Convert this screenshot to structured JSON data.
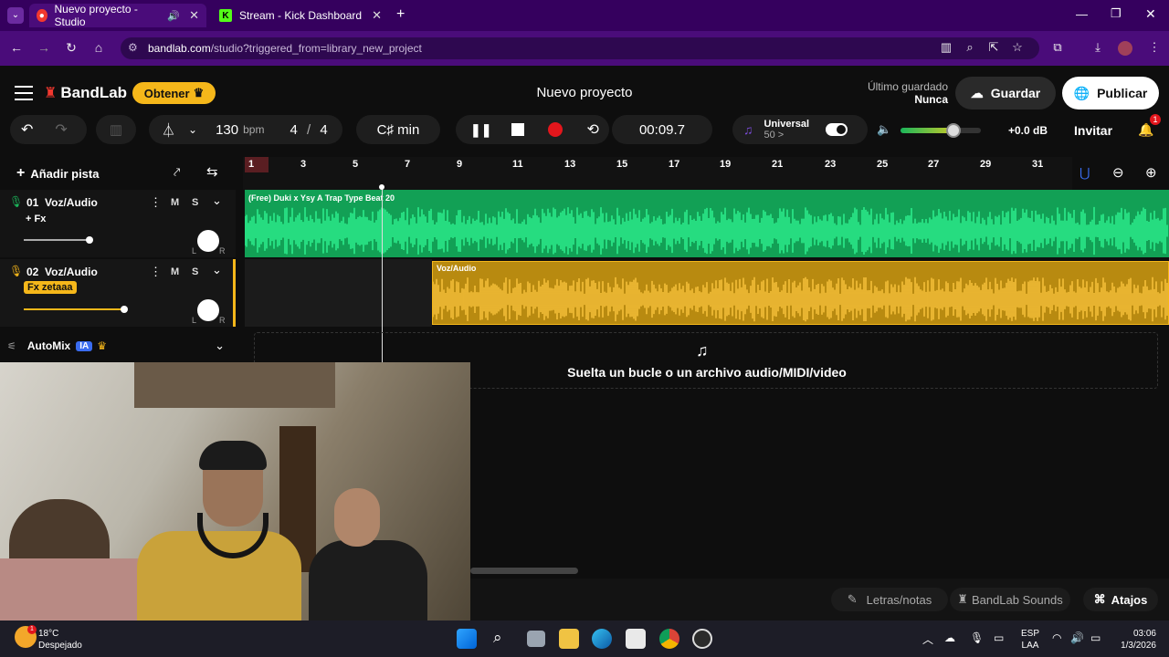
{
  "browser": {
    "tabs": [
      {
        "title": "Nuevo proyecto - Studio",
        "active": true
      },
      {
        "title": "Stream - Kick Dashboard",
        "active": false
      }
    ],
    "url_domain": "bandlab.com",
    "url_path": "/studio?triggered_from=library_new_project"
  },
  "header": {
    "logo": "BandLab",
    "obtener": "Obtener",
    "project_title": "Nuevo proyecto",
    "last_saved_label": "Último guardado",
    "last_saved_value": "Nunca",
    "guardar": "Guardar",
    "publicar": "Publicar"
  },
  "transport": {
    "bpm_value": "130",
    "bpm_unit": "bpm",
    "time_sig_num": "4",
    "time_sig_sep": "/",
    "time_sig_den": "4",
    "key": "C♯ min",
    "time": "00:09.7",
    "preset_name": "Universal",
    "preset_value": "50 >",
    "volume_db": "+0.0 dB",
    "invitar": "Invitar",
    "notifications": "1"
  },
  "timeline": {
    "add_track": "Añadir pista",
    "ruler": [
      "1",
      "3",
      "5",
      "7",
      "9",
      "11",
      "13",
      "15",
      "17",
      "19",
      "21",
      "23",
      "25",
      "27",
      "29",
      "31"
    ]
  },
  "tracks": [
    {
      "number": "01",
      "name": "Voz/Audio",
      "fx": "+ Fx",
      "m": "M",
      "s": "S",
      "clip_title": "(Free) Duki  x Ysy A  Trap Type Beat  20"
    },
    {
      "number": "02",
      "name": "Voz/Audio",
      "fx": "Fx zetaaa",
      "m": "M",
      "s": "S",
      "clip_title": "Voz/Audio"
    }
  ],
  "automix": {
    "label": "AutoMix",
    "badge": "IA"
  },
  "drop_zone": "Suelta un bucle o un archivo audio/MIDI/video",
  "footer": {
    "letras": "Letras/notas",
    "sounds": "BandLab Sounds",
    "atajos": "Atajos"
  },
  "taskbar": {
    "weather_temp": "18°C",
    "weather_desc": "Despejado",
    "lang_1": "ESP",
    "lang_2": "LAA",
    "time": "03:06",
    "date": "1/3/2026"
  },
  "colors": {
    "accent_orange": "#f5b71a",
    "green_track": "#12a055",
    "brand_red": "#f2382f",
    "browser_purple": "#4a0c7a"
  }
}
